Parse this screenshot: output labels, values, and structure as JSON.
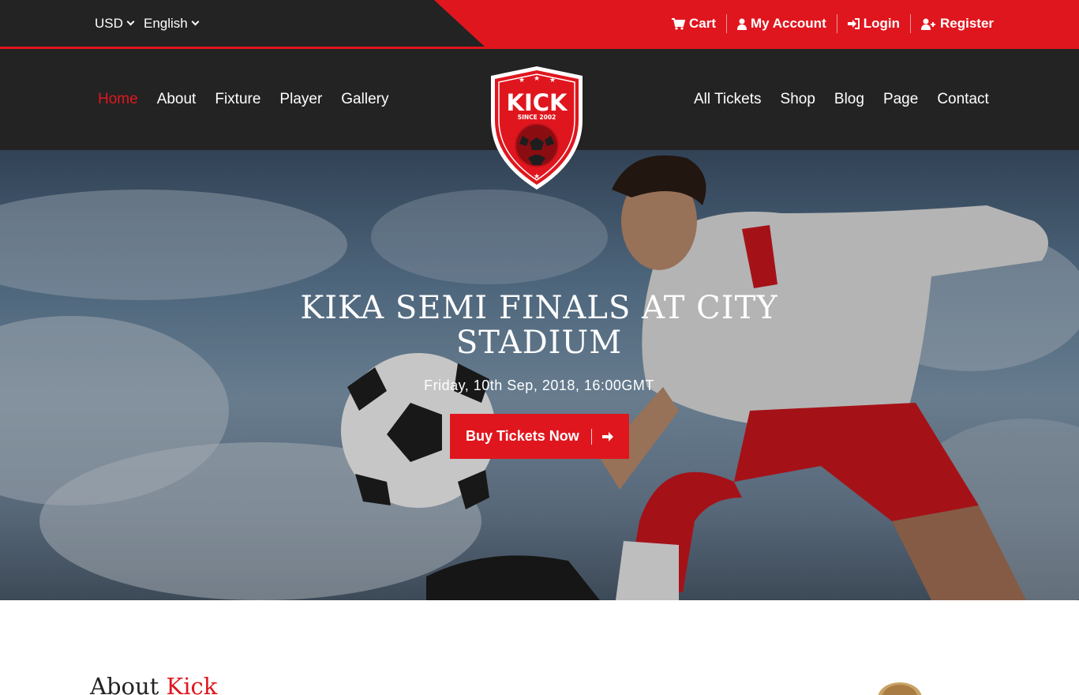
{
  "topbar": {
    "currency": "USD",
    "language": "English",
    "links": [
      {
        "label": "Cart",
        "icon": "cart-icon"
      },
      {
        "label": "My Account",
        "icon": "user-icon"
      },
      {
        "label": "Login",
        "icon": "sign-in-icon"
      },
      {
        "label": "Register",
        "icon": "user-plus-icon"
      }
    ]
  },
  "nav": {
    "left": [
      "Home",
      "About",
      "Fixture",
      "Player",
      "Gallery"
    ],
    "right": [
      "All Tickets",
      "Shop",
      "Blog",
      "Page",
      "Contact"
    ],
    "active": "Home"
  },
  "logo": {
    "name": "KICK",
    "tagline": "SINCE 2002"
  },
  "hero": {
    "title": "KIKA SEMI FINALS AT CITY STADIUM",
    "date": "Friday, 10th Sep, 2018, 16:00GMT",
    "button_label": "Buy Tickets Now",
    "button_icon": "arrow-right-icon"
  },
  "about": {
    "title_part1": "About",
    "title_part2": "Kick"
  },
  "colors": {
    "accent": "#e0161e",
    "dark": "#232323"
  }
}
